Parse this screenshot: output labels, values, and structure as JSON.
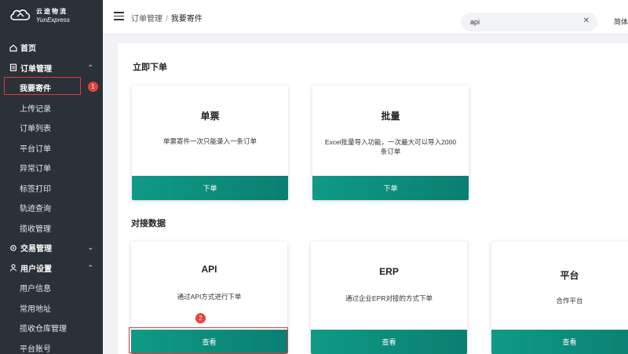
{
  "logo": {
    "cn": "云途物流",
    "en": "YunExpress"
  },
  "sidebar": {
    "home": "首页",
    "groups": {
      "orders": "订单管理",
      "trade": "交易管理",
      "user": "用户设置"
    },
    "order_items": [
      "我要寄件",
      "上传记录",
      "订单列表",
      "平台订单",
      "异常订单",
      "标签打印",
      "轨迹查询",
      "揽收管理"
    ],
    "user_items": [
      "用户信息",
      "常用地址",
      "揽收仓库管理",
      "平台账号"
    ]
  },
  "header": {
    "breadcrumb": [
      "订单管理",
      "我要寄件"
    ],
    "search_value": "api",
    "lang": "简体"
  },
  "sections": {
    "place_order": "立即下单",
    "integration": "对接数据"
  },
  "cards": {
    "single": {
      "title": "单票",
      "desc": "单票寄件一次只能录入一条订单",
      "button": "下单"
    },
    "batch": {
      "title": "批量",
      "desc": "Excel批量导入功能，一次最大可以导入2000条订单",
      "button": "下单"
    },
    "api": {
      "title": "API",
      "desc": "通过API方式进行下单",
      "button": "查看"
    },
    "erp": {
      "title": "ERP",
      "desc": "通过企业EPR对接的方式下单",
      "button": "查看"
    },
    "platform": {
      "title": "平台",
      "desc": "合作平台",
      "button": "查看"
    }
  },
  "annotations": {
    "step1": "1",
    "step2": "2"
  },
  "colors": {
    "sidebar_bg": "#2b3138",
    "accent": "#0f9a86",
    "highlight": "#e03a3a"
  }
}
